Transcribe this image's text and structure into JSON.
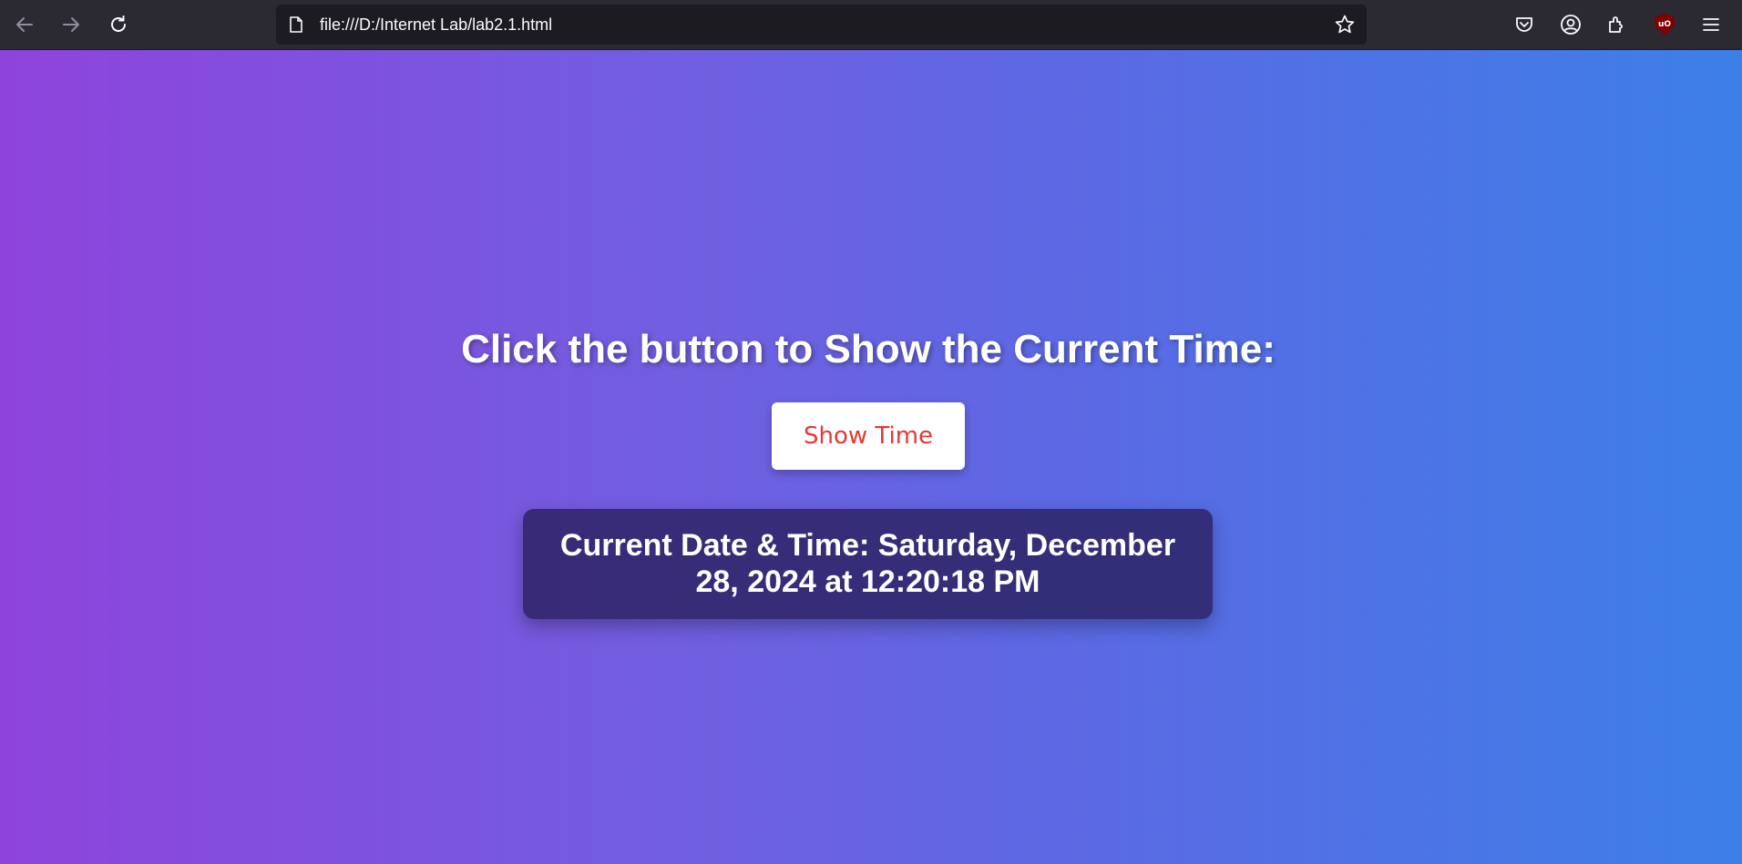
{
  "browser": {
    "url": "file:///D:/Internet Lab/lab2.1.html",
    "icons": {
      "back": "arrow-left-icon",
      "forward": "arrow-right-icon",
      "reload": "reload-icon",
      "page": "page-icon",
      "bookmark": "star-icon",
      "pocket": "pocket-icon",
      "account": "account-icon",
      "extensions": "puzzle-icon",
      "ublock": "ublock-icon",
      "menu": "hamburger-menu-icon"
    },
    "ublock_label": "uO"
  },
  "page": {
    "heading": "Click the button to Show the Current Time:",
    "button_label": "Show Time",
    "time_display": "Current Date & Time: Saturday, December 28, 2024 at 12:20:18 PM"
  },
  "colors": {
    "gradient_start": "#8e44dc",
    "gradient_end": "#3d7fe8",
    "button_text": "#e53935",
    "toolbar_bg": "#2b2a33",
    "urlbar_bg": "#1c1b22",
    "time_box_bg": "#2d2365"
  }
}
